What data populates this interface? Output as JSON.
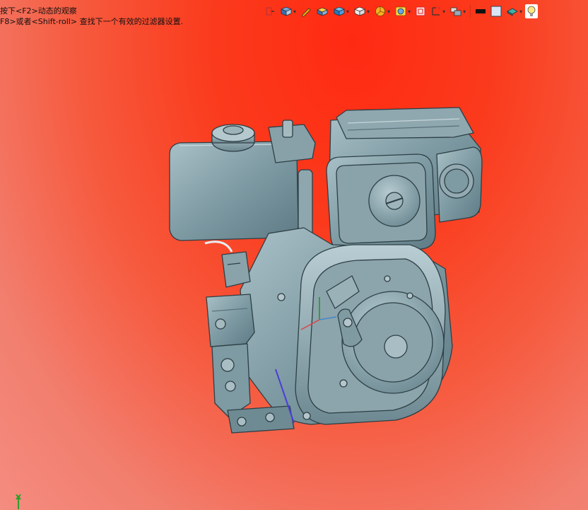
{
  "hint": {
    "line1": "按下<F2>动态的观察",
    "line2": "F8>或者<Shift-roll> 查找下一个有效的过滤器设置."
  },
  "toolbar": {
    "items": [
      {
        "icon": "view-fit-icon",
        "has_menu": false
      },
      {
        "icon": "view-orientation-icon",
        "has_menu": true
      },
      {
        "icon": "sketch-pencil-icon",
        "has_menu": false
      },
      {
        "icon": "section-view-icon",
        "has_menu": false
      },
      {
        "icon": "display-style-icon",
        "has_menu": true
      },
      {
        "icon": "hide-show-icon",
        "has_menu": true
      },
      {
        "icon": "appearance-icon",
        "has_menu": true
      },
      {
        "icon": "scene-icon",
        "has_menu": true
      },
      {
        "icon": "view-settings-icon",
        "has_menu": false
      },
      {
        "icon": "lighting-icon",
        "has_menu": true
      },
      {
        "icon": "camera-icon",
        "has_menu": true
      },
      {
        "icon": "color-black-icon",
        "has_menu": false
      },
      {
        "icon": "color-white-icon",
        "has_menu": false
      },
      {
        "icon": "render-icon",
        "has_menu": true
      },
      {
        "icon": "bulb-icon",
        "has_menu": false
      }
    ]
  },
  "triad": {
    "axis_label": "Y"
  },
  "colors": {
    "model": "#7e9aa3",
    "model_dark": "#3e575f",
    "bg_top": "#ff2a12",
    "bg_bottom": "#f48c80"
  }
}
